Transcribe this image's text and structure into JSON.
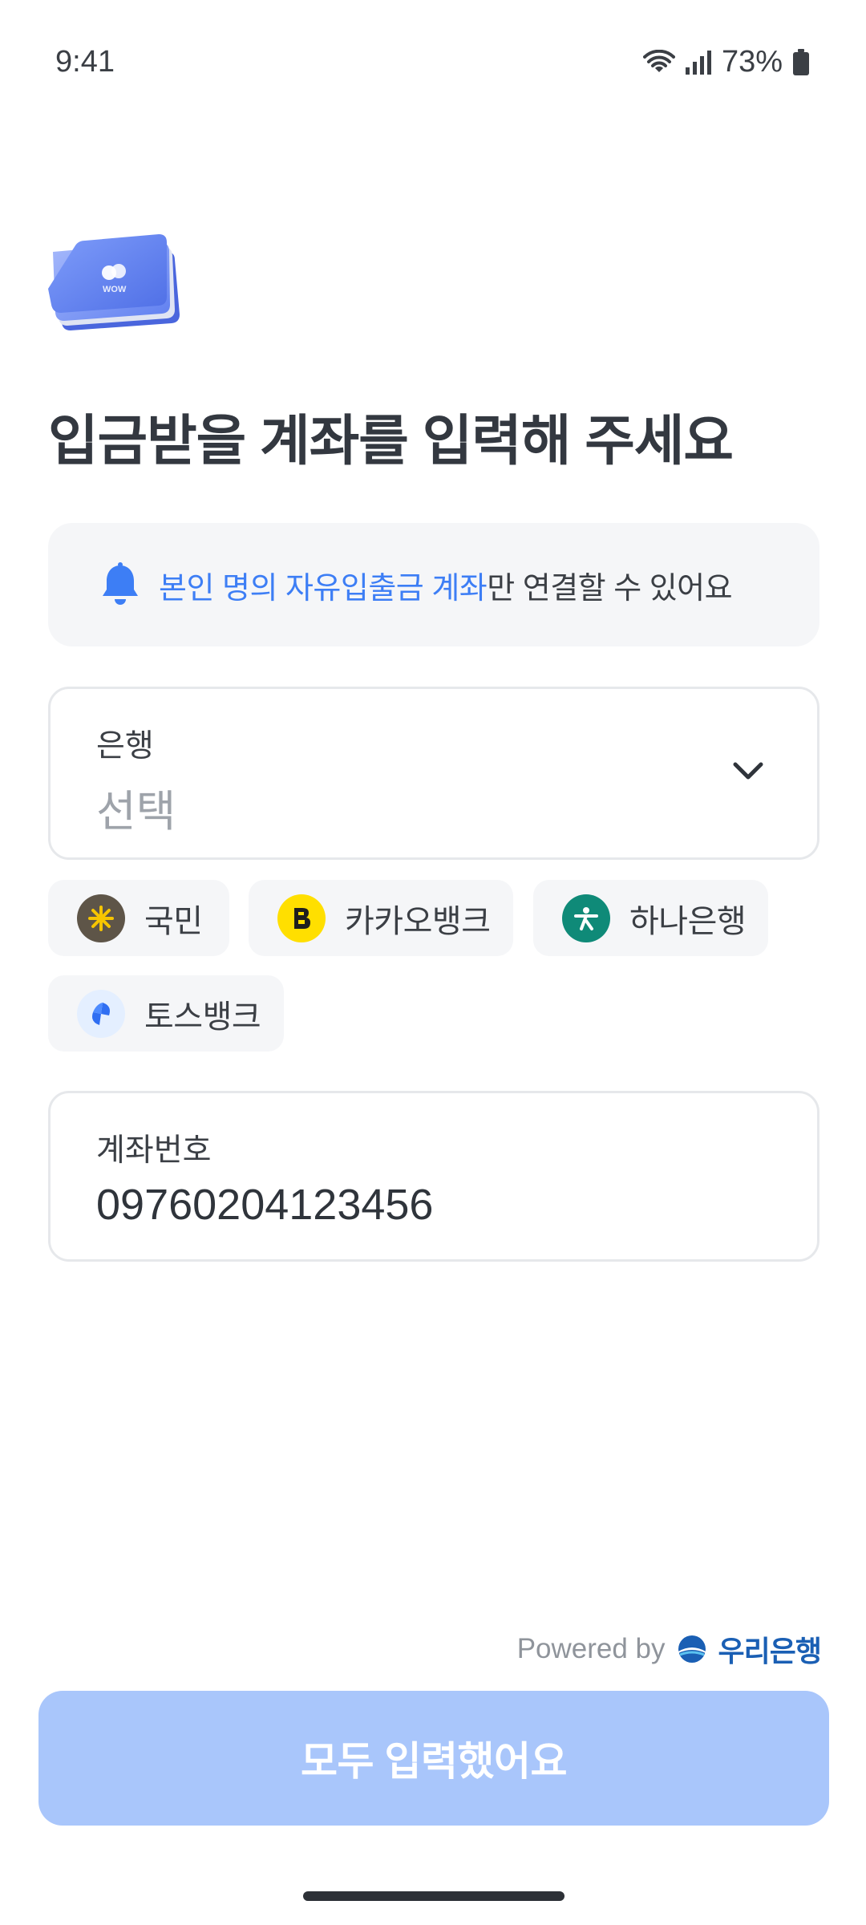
{
  "status_bar": {
    "time": "9:41",
    "battery": "73%"
  },
  "title": "입금받을 계좌를 입력해 주세요",
  "notice": {
    "highlight": "본인 명의 자유입출금 계좌",
    "rest": "만 연결할 수 있어요",
    "accent_color": "#3d7ef5"
  },
  "bank_field": {
    "label": "은행",
    "value": "선택"
  },
  "bank_chips": [
    {
      "label": "국민",
      "icon": "kb-bank-icon"
    },
    {
      "label": "카카오뱅크",
      "icon": "kakaobank-icon"
    },
    {
      "label": "하나은행",
      "icon": "hana-bank-icon"
    },
    {
      "label": "토스뱅크",
      "icon": "tossbank-icon"
    }
  ],
  "account_field": {
    "label": "계좌번호",
    "value": "09760204123456"
  },
  "powered_by": {
    "text": "Powered by",
    "brand": "우리은행"
  },
  "submit": {
    "label": "모두 입력했어요",
    "color": "#a9c6fb"
  }
}
